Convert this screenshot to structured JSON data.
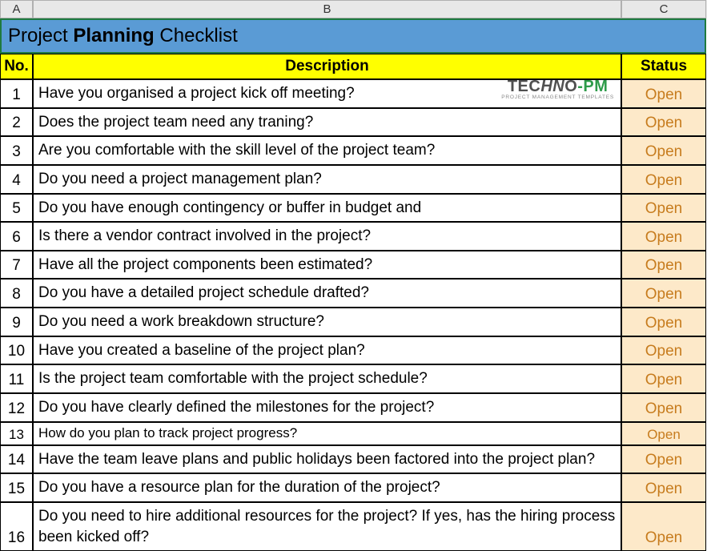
{
  "columns": {
    "a": "A",
    "b": "B",
    "c": "C"
  },
  "title": {
    "prefix": "Project ",
    "bold": "Planning",
    "suffix": " Checklist"
  },
  "headers": {
    "no": "No.",
    "description": "Description",
    "status": "Status"
  },
  "logo": {
    "part1": "TEC",
    "part2": "HN",
    "part3": "O",
    "part4": "-PM",
    "sub": "PROJECT MANAGEMENT TEMPLATES"
  },
  "rows": [
    {
      "no": "1",
      "desc": "Have you organised a project kick off meeting?",
      "status": "Open"
    },
    {
      "no": "2",
      "desc": "Does the project team need any traning?",
      "status": "Open"
    },
    {
      "no": "3",
      "desc": "Are you comfortable with the skill level of the project team?",
      "status": "Open"
    },
    {
      "no": "4",
      "desc": "Do you need a project management plan?",
      "status": "Open"
    },
    {
      "no": "5",
      "desc": "Do you have enough contingency or buffer in budget and",
      "status": "Open"
    },
    {
      "no": "6",
      "desc": "Is there a vendor contract involved in the project?",
      "status": "Open"
    },
    {
      "no": "7",
      "desc": "Have all the project components been estimated?",
      "status": "Open"
    },
    {
      "no": "8",
      "desc": "Do you have a detailed project schedule drafted?",
      "status": "Open"
    },
    {
      "no": "9",
      "desc": "Do you need a work breakdown structure?",
      "status": "Open"
    },
    {
      "no": "10",
      "desc": "Have you created a baseline of the project plan?",
      "status": "Open"
    },
    {
      "no": "11",
      "desc": "Is the project team comfortable with the project schedule?",
      "status": "Open"
    },
    {
      "no": "12",
      "desc": "Do you have clearly defined the milestones for the project?",
      "status": "Open"
    },
    {
      "no": "13",
      "desc": "How do you plan to track project progress?",
      "status": "Open"
    },
    {
      "no": "14",
      "desc": "Have the team leave plans and public holidays been factored into the project plan?",
      "status": "Open"
    },
    {
      "no": "15",
      "desc": "Do you have a resource plan for the duration of the project?",
      "status": "Open"
    },
    {
      "no": "16",
      "desc": "Do you need to hire additional resources for the project? If yes, has the hiring process been kicked off?",
      "status": "Open"
    }
  ]
}
